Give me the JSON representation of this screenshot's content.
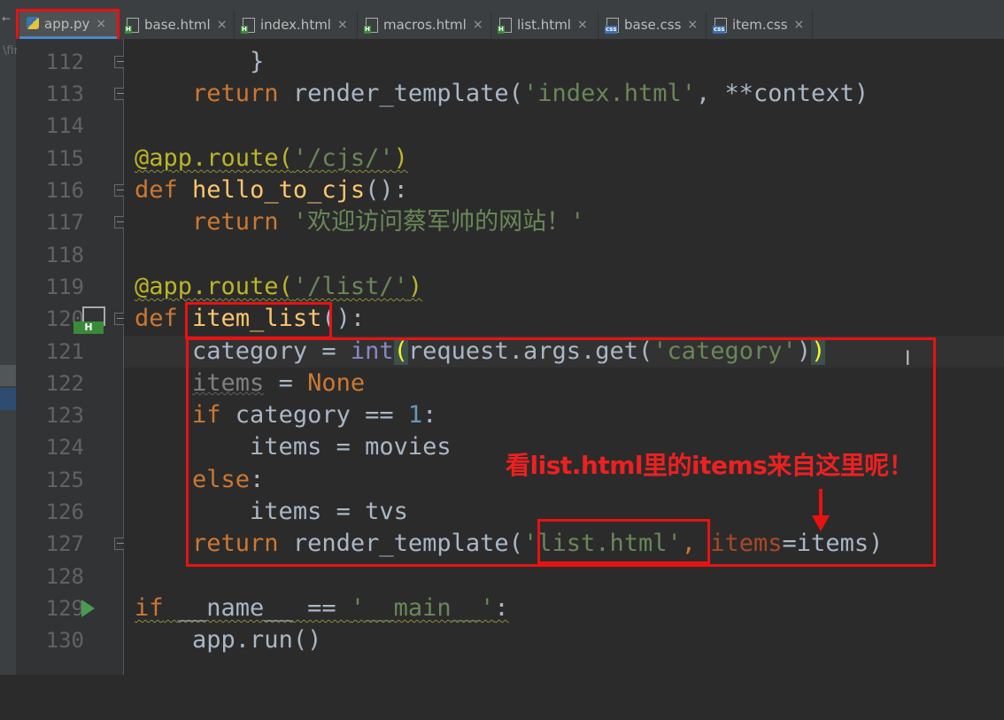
{
  "tabs": [
    {
      "label": "app.py",
      "icon": "python-file-icon",
      "active": true
    },
    {
      "label": "base.html",
      "icon": "html-file-icon"
    },
    {
      "label": "index.html",
      "icon": "html-file-icon"
    },
    {
      "label": "macros.html",
      "icon": "html-file-icon"
    },
    {
      "label": "list.html",
      "icon": "html-file-icon"
    },
    {
      "label": "base.css",
      "icon": "css-file-icon"
    },
    {
      "label": "item.css",
      "icon": "css-file-icon"
    }
  ],
  "tab_close_glyph": "×",
  "icon_badges": {
    "html": "H",
    "css": "css"
  },
  "project_stub": "\\fir",
  "collapse_arrow": "←",
  "code": {
    "l112": {
      "num": "112",
      "brace": "}"
    },
    "l113": {
      "num": "113",
      "kw": "return",
      "fn": "render_template(",
      "str": "'index.html'",
      "rest": ", **context)"
    },
    "l114": {
      "num": "114"
    },
    "l115": {
      "num": "115",
      "deco": "@app.route(",
      "str": "'/cjs/'",
      "close": ")"
    },
    "l116": {
      "num": "116",
      "kw": "def",
      "fn": "hello_to_cjs",
      "rest": "():"
    },
    "l117": {
      "num": "117",
      "kw": "return",
      "str": "'欢迎访问蔡军帅的网站！'"
    },
    "l118": {
      "num": "118"
    },
    "l119": {
      "num": "119",
      "deco": "@app.route(",
      "str": "'/list/'",
      "close": ")"
    },
    "l120": {
      "num": "120",
      "kw": "def",
      "fn": "item_list",
      "rest": "():"
    },
    "l121": {
      "num": "121",
      "var": "category",
      "eq": " = ",
      "builtin": "int",
      "open": "(",
      "mid": "request.args.get(",
      "str": "'category'",
      "close1": ")",
      "close2": ")"
    },
    "l122": {
      "num": "122",
      "var": "items",
      "eq": " = ",
      "none": "None"
    },
    "l123": {
      "num": "123",
      "kw": "if",
      "cond": " category == ",
      "num_lit": "1",
      "colon": ":"
    },
    "l124": {
      "num": "124",
      "text": "items = movies"
    },
    "l125": {
      "num": "125",
      "kw": "else",
      "colon": ":"
    },
    "l126": {
      "num": "126",
      "text": "items = tvs"
    },
    "l127": {
      "num": "127",
      "kw": "return",
      "fn": "render_template(",
      "str": "'list.html'",
      "comma": ", ",
      "kwarg": "items",
      "rest": "=items)"
    },
    "l128": {
      "num": "128"
    },
    "l129": {
      "num": "129",
      "kw": "if",
      "dunder": "__name__",
      "eq": " == ",
      "str": "'__main__'",
      "colon": ":"
    },
    "l130": {
      "num": "130",
      "text": "app.run()"
    }
  },
  "gutter_marker_label": "H",
  "annotation": "看list.html里的items来自这里呢！",
  "text_cursor": "I"
}
